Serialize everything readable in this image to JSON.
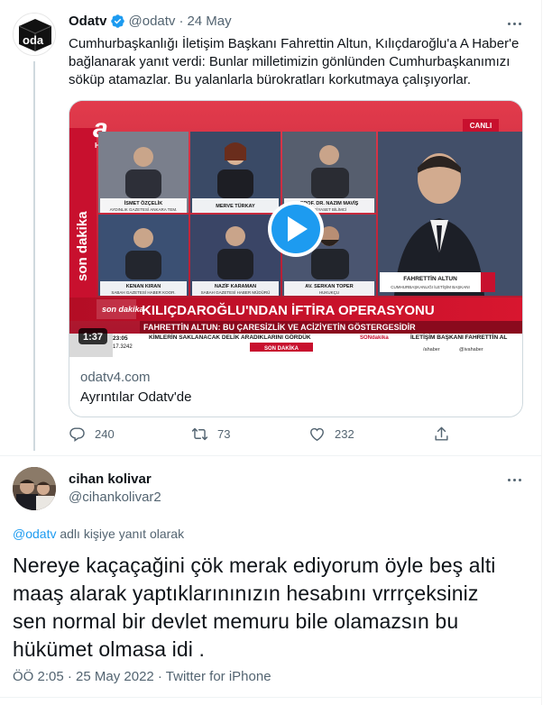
{
  "parent_tweet": {
    "avatar_logo": "oda",
    "name": "Odatv",
    "handle": "@odatv",
    "separator": "·",
    "date": "24 May",
    "text": "Cumhurbaşkanlığı İletişim Başkanı Fahrettin Altun, Kılıçdaroğlu'a A Haber'e bağlanarak yanıt verdi: Bunlar milletimizin gönlünden Cumhurbaşkanımızı söküp atamazlar. Bu yalanlarla bürokratları korkutmaya çalışıyorlar.",
    "card": {
      "domain": "odatv4.com",
      "title": "Ayrıntılar Odatv'de",
      "video": {
        "logo": "a",
        "logo_sub": "HBR",
        "live_badge": "CANLI",
        "duration": "1:37",
        "son_dakika_vertical": "son dakika",
        "panels": [
          {
            "name": "İSMET ÖZÇELİK",
            "sub": "AYDINLIK GAZETESİ ANKARA TEM."
          },
          {
            "name": "MERVE TÜRKAY",
            "sub": ""
          },
          {
            "name": "PROF. DR. NAZIM MAVİŞ",
            "sub": "/ SİYASET BİLİMCİ"
          },
          {
            "name": "KENAN KIRAN",
            "sub": "SABAH GAZETESİ HABER KOOR."
          },
          {
            "name": "NAZİF KARAMAN",
            "sub": "SABAH GAZETESİ HABER MÜDÜRÜ"
          },
          {
            "name": "AV. SERKAN TOPER",
            "sub": "HUKUKÇU"
          }
        ],
        "guest_name": "FAHRETTİN ALTUN",
        "guest_title": "CUMHURBAŞKANLIĞI İLETİŞİM BAŞKANI",
        "headline_badge": "son dakika",
        "headline": "KILIÇDAROĞLU'NDAN İFTİRA OPERASYONU",
        "subheadline": "FAHRETTİN ALTUN: BU ÇARESİZLİK VE ACİZİYETİN GÖSTERGESİDİR",
        "ticker_time": "23:05",
        "ticker_index": "17.3242",
        "ticker_text_1": "KİMLERİN SAKLANACAK DELİK ARADIKLARINI GÖRDÜK",
        "ticker_label": "SON DAKİKA",
        "ticker_brand": "SONdakika",
        "ticker_text_2": "İLETİŞİM BAŞKANI FAHRETTİN AL",
        "ticker_social": "/ahaber",
        "ticker_social_2": "@ivahaber"
      }
    },
    "actions": {
      "replies": "240",
      "retweets": "73",
      "likes": "232"
    }
  },
  "reply_tweet": {
    "name": "cihan kolivar",
    "handle": "@cihankolivar2",
    "reply_prefix_handle": "@odatv",
    "reply_suffix": " adlı kişiye yanıt olarak",
    "text": "Nereye kaçaçağini çök merak ediyorum öyle beş alti maaş alarak yaptıklarınınızın hesabını vrrrçeksiniz sen normal bir devlet memuru bile olamazsın bu hükümet olmasa idi .",
    "meta": "ÖÖ 2:05 · 25 May 2022 · Twitter for iPhone"
  },
  "colors": {
    "accent": "#1d9bf0",
    "muted": "#536471",
    "text": "#0f1419",
    "ahaber_red": "#c8102e"
  }
}
